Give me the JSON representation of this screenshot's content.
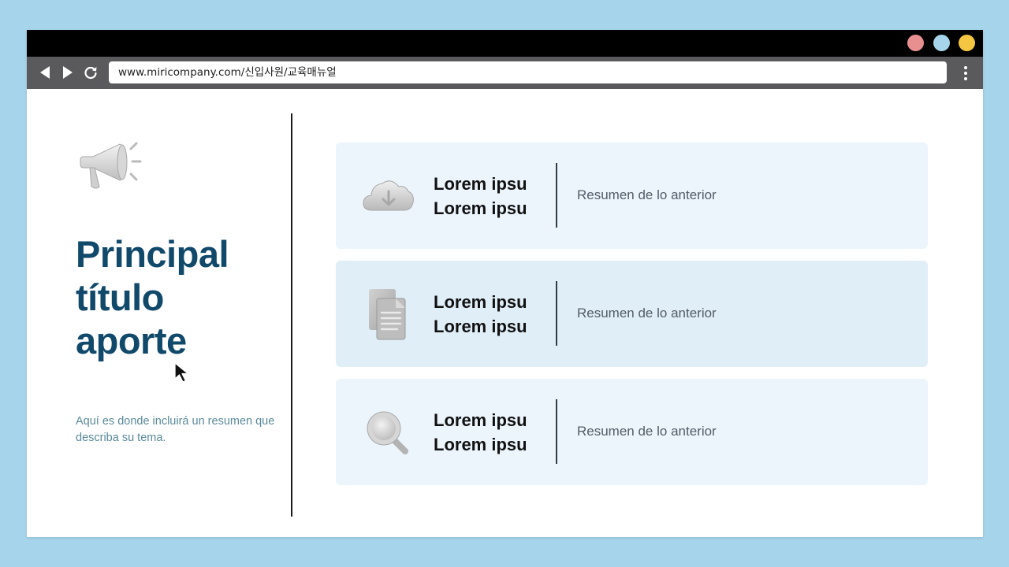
{
  "browser": {
    "url": "www.miricompany.com/신입사원/교육매뉴얼",
    "window_dots": [
      "#e88f8f",
      "#a6d4ea",
      "#f4c642"
    ]
  },
  "hero": {
    "title_lines": [
      "Principal",
      "título",
      "aporte"
    ],
    "summary": "Aquí es donde incluirá un resumen que describa su tema."
  },
  "cards": [
    {
      "icon": "cloud-download-icon",
      "title_line1": "Lorem ipsu",
      "title_line2": "Lorem ipsu",
      "desc": "Resumen de lo anterior"
    },
    {
      "icon": "documents-icon",
      "title_line1": "Lorem ipsu",
      "title_line2": "Lorem ipsu",
      "desc": "Resumen de lo anterior"
    },
    {
      "icon": "magnifier-icon",
      "title_line1": "Lorem ipsu",
      "title_line2": "Lorem ipsu",
      "desc": "Resumen de lo anterior"
    }
  ],
  "colors": {
    "title": "#11496a",
    "summary": "#5a8a99",
    "card_bg": "#ecf5fc",
    "card_bg_alt": "#e0eef8",
    "page_bg": "#a6d4ea"
  }
}
